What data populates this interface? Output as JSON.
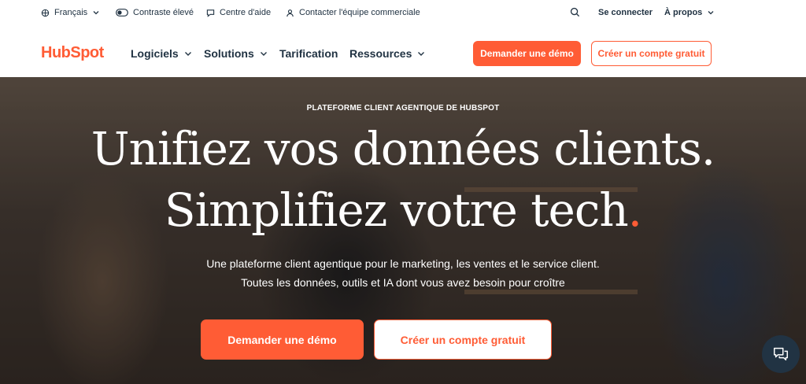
{
  "utility": {
    "language": "Français",
    "contrast": "Contraste élevé",
    "help": "Centre d'aide",
    "sales": "Contacter l'équipe commerciale",
    "login": "Se connecter",
    "about": "À propos"
  },
  "nav": {
    "logo": "HubSpot",
    "items": [
      "Logiciels",
      "Solutions",
      "Tarification",
      "Ressources"
    ],
    "demo_button": "Demander une démo",
    "signup_button": "Créer un compte gratuit"
  },
  "hero": {
    "eyebrow": "PLATEFORME CLIENT AGENTIQUE DE HUBSPOT",
    "headline_line1": "Unifiez vos données clients.",
    "headline_line2": "Simplifiez votre tech",
    "headline_dot": ".",
    "subtitle_line1": "Une plateforme client agentique pour le marketing, les ventes et le service client.",
    "subtitle_line2": "Toutes les données, outils et IA dont vous avez besoin pour croître",
    "demo_button": "Demander une démo",
    "signup_button": "Créer un compte gratuit"
  },
  "colors": {
    "brand": "#ff5c35",
    "text_dark": "#213343"
  },
  "icons": [
    "globe-icon",
    "contrast-toggle-icon",
    "help-chat-icon",
    "person-icon",
    "search-icon",
    "chevron-down-icon",
    "chat-bubbles-icon"
  ]
}
